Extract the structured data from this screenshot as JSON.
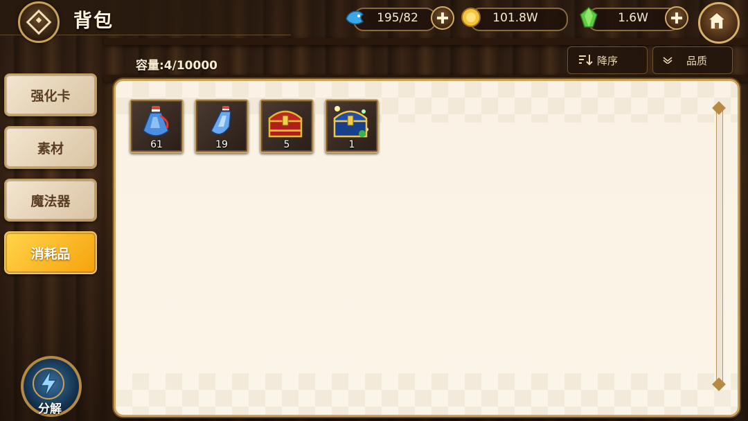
{
  "header": {
    "title": "背包"
  },
  "currencies": [
    {
      "icon": "blue-fish-icon",
      "value": "195/82",
      "has_plus": true,
      "color": "#3da6e8"
    },
    {
      "icon": "gold-coin-icon",
      "value": "101.8W",
      "has_plus": false,
      "color": "#f3c33a"
    },
    {
      "icon": "green-gem-icon",
      "value": "1.6W",
      "has_plus": true,
      "color": "#5ecb3e"
    }
  ],
  "inventory": {
    "capacity_label": "容量:4/10000",
    "sort_label": "降序",
    "filter_label": "品质",
    "items": [
      {
        "icon": "blue-potion-large-icon",
        "count": "61"
      },
      {
        "icon": "blue-potion-small-icon",
        "count": "19"
      },
      {
        "icon": "red-treasure-chest-icon",
        "count": "5"
      },
      {
        "icon": "blue-treasure-chest-icon",
        "count": "1"
      }
    ]
  },
  "sidebar": {
    "tabs": [
      {
        "label": "强化卡",
        "active": false
      },
      {
        "label": "素材",
        "active": false
      },
      {
        "label": "魔法器",
        "active": false
      },
      {
        "label": "消耗品",
        "active": true
      }
    ],
    "decompose_label": "分解"
  },
  "colors": {
    "accent_gold": "#c9a25c",
    "active_tab": "#f6a20c",
    "panel_bg": "#faf2e4"
  }
}
